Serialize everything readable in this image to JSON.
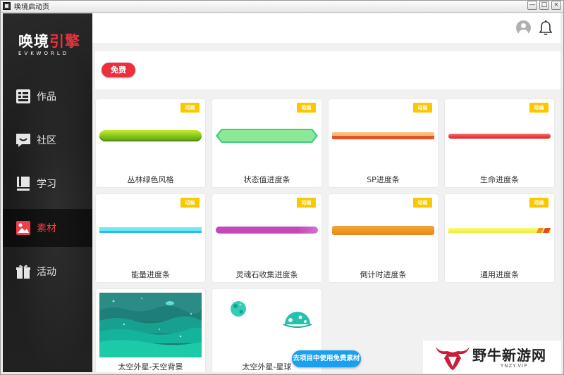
{
  "window": {
    "title": "唤境启动页",
    "min_glyph": "—",
    "max_glyph": "□",
    "close_glyph": "×"
  },
  "logo": {
    "cn_white": "唤境",
    "cn_red": "引擎",
    "en": "EVKWORLD"
  },
  "sidebar": {
    "items": [
      {
        "label": "作品",
        "icon": "works-icon",
        "active": false
      },
      {
        "label": "社区",
        "icon": "community-icon",
        "active": false
      },
      {
        "label": "学习",
        "icon": "learn-icon",
        "active": false
      },
      {
        "label": "素材",
        "icon": "assets-icon",
        "active": true
      },
      {
        "label": "活动",
        "icon": "gift-icon",
        "active": false
      }
    ]
  },
  "header": {
    "avatar_icon": "avatar-icon",
    "bell_icon": "bell-icon"
  },
  "filter": {
    "free_label": "免费"
  },
  "cards": [
    {
      "label": "丛林绿色风格",
      "badge": "动画"
    },
    {
      "label": "状态值进度条",
      "badge": "动画"
    },
    {
      "label": "SP进度条",
      "badge": "动画"
    },
    {
      "label": "生命进度条",
      "badge": "动画"
    },
    {
      "label": "能量进度条",
      "badge": "动画"
    },
    {
      "label": "灵魂石收集进度条",
      "badge": "动画"
    },
    {
      "label": "倒计时进度条",
      "badge": "动画"
    },
    {
      "label": "通用进度条",
      "badge": "动画"
    },
    {
      "label": "太空外星-天空背景",
      "badge": ""
    },
    {
      "label": "太空外星-星球",
      "badge": ""
    }
  ],
  "cta": {
    "label": "去项目中使用免费素材"
  },
  "watermark": {
    "text": "野牛新游网",
    "url": "YNZY.VIP"
  },
  "colors": {
    "accent_red": "#e9303c",
    "badge_yellow": "#fbc800",
    "cta_blue": "#1aa0f0",
    "sidebar_bg": "#1f1f1f"
  }
}
